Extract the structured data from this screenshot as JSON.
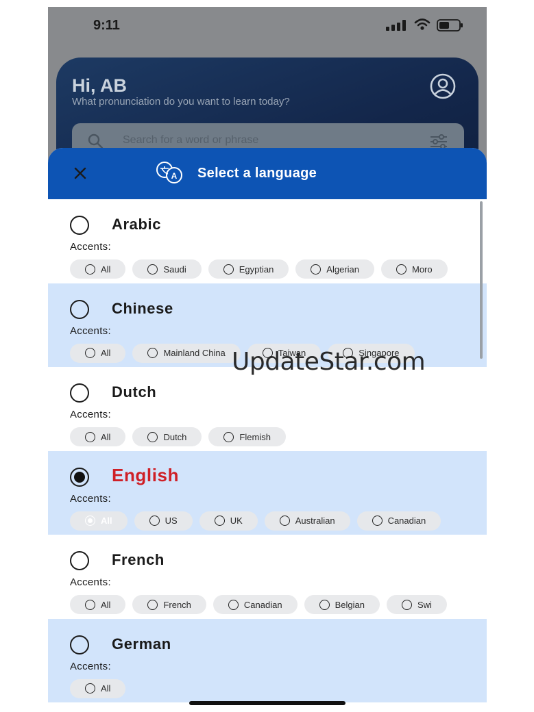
{
  "status_bar": {
    "time": "9:11"
  },
  "header": {
    "greeting": "Hi, AB",
    "subtitle": "What pronunciation do you want to learn today?",
    "search_placeholder": "Search for a word or phrase"
  },
  "sheet": {
    "title": "Select a language",
    "accents_label": "Accents:",
    "languages": [
      {
        "name": "Arabic",
        "selected": false,
        "accents": [
          "All",
          "Saudi",
          "Egyptian",
          "Algerian",
          "Moro"
        ]
      },
      {
        "name": "Chinese",
        "selected": false,
        "accents": [
          "All",
          "Mainland China",
          "Taiwan",
          "Singapore"
        ]
      },
      {
        "name": "Dutch",
        "selected": false,
        "accents": [
          "All",
          "Dutch",
          "Flemish"
        ]
      },
      {
        "name": "English",
        "selected": true,
        "active_accent": "All",
        "accents": [
          "All",
          "US",
          "UK",
          "Australian",
          "Canadian"
        ]
      },
      {
        "name": "French",
        "selected": false,
        "accents": [
          "All",
          "French",
          "Canadian",
          "Belgian",
          "Swi"
        ]
      },
      {
        "name": "German",
        "selected": false,
        "accents": [
          "All"
        ]
      }
    ]
  },
  "watermark": "UpdateStar.com",
  "colors": {
    "sheet_header": "#0d54b4",
    "alt_row": "#d2e4fb",
    "selected": "#cf1f26",
    "active_chip": "#d71f26"
  }
}
